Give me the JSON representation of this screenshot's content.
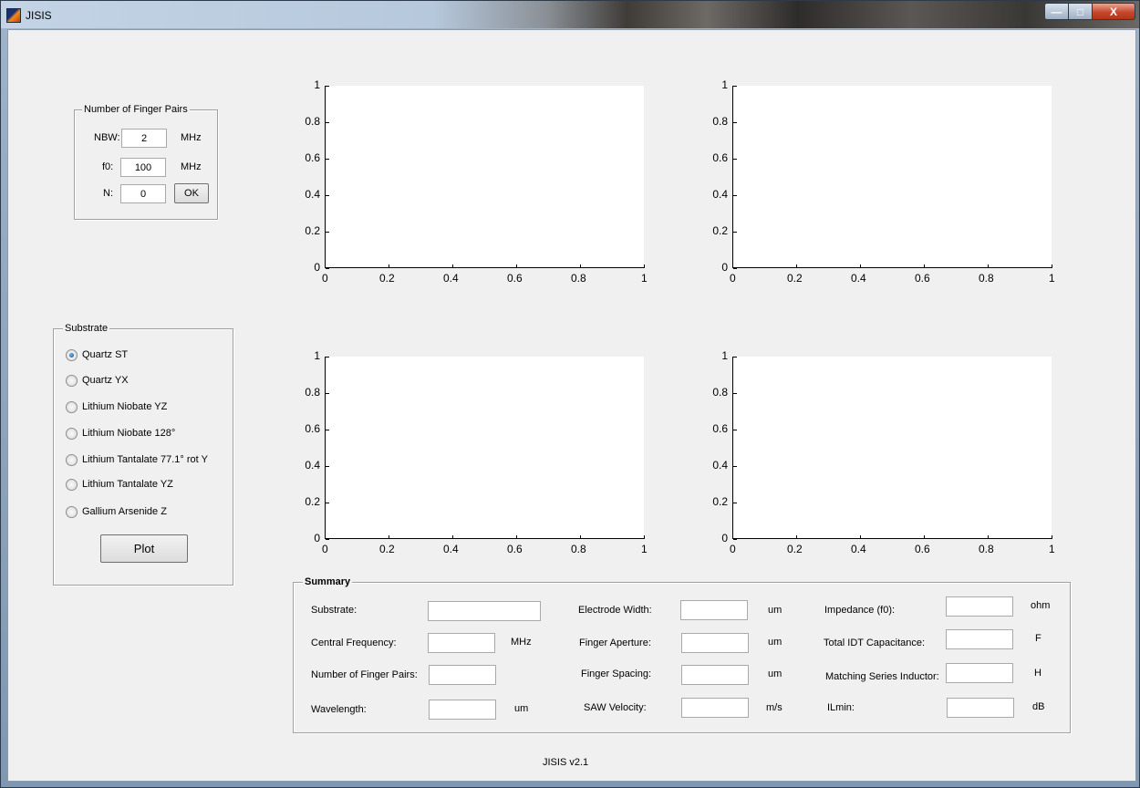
{
  "window": {
    "title": "JISIS",
    "min_glyph": "—",
    "max_glyph": "□",
    "close_glyph": "X"
  },
  "finger_pairs": {
    "legend": "Number of Finger Pairs",
    "nbw_label": "NBW:",
    "nbw_value": "2",
    "nbw_unit": "MHz",
    "f0_label": "f0:",
    "f0_value": "100",
    "f0_unit": "MHz",
    "n_label": "N:",
    "n_value": "0",
    "ok_label": "OK"
  },
  "substrate": {
    "legend": "Substrate",
    "options": [
      {
        "label": "Quartz ST",
        "selected": true
      },
      {
        "label": "Quartz YX",
        "selected": false
      },
      {
        "label": "Lithium Niobate YZ",
        "selected": false
      },
      {
        "label": "Lithium Niobate 128°",
        "selected": false
      },
      {
        "label": "Lithium Tantalate 77.1° rot Y",
        "selected": false
      },
      {
        "label": "Lithium Tantalate YZ",
        "selected": false
      },
      {
        "label": "Gallium Arsenide Z",
        "selected": false
      }
    ],
    "plot_label": "Plot"
  },
  "axes_ticks": {
    "y": [
      "0",
      "0.2",
      "0.4",
      "0.6",
      "0.8",
      "1"
    ],
    "x": [
      "0",
      "0.2",
      "0.4",
      "0.6",
      "0.8",
      "1"
    ]
  },
  "summary": {
    "legend": "Summary",
    "substrate_label": "Substrate:",
    "central_frequency_label": "Central Frequency:",
    "central_frequency_unit": "MHz",
    "finger_pairs_label": "Number of Finger Pairs:",
    "wavelength_label": "Wavelength:",
    "wavelength_unit": "um",
    "electrode_width_label": "Electrode Width:",
    "electrode_width_unit": "um",
    "finger_aperture_label": "Finger Aperture:",
    "finger_aperture_unit": "um",
    "finger_spacing_label": "Finger Spacing:",
    "finger_spacing_unit": "um",
    "saw_velocity_label": "SAW Velocity:",
    "saw_velocity_unit": "m/s",
    "impedance_label": "Impedance (f0):",
    "impedance_unit": "ohm",
    "capacitance_label": "Total IDT Capacitance:",
    "capacitance_unit": "F",
    "inductor_label": "Matching Series Inductor:",
    "inductor_unit": "H",
    "ilmin_label": "ILmin:",
    "ilmin_unit": "dB"
  },
  "version": "JISIS v2.1"
}
